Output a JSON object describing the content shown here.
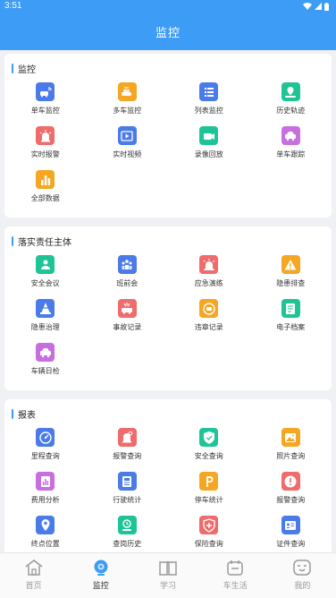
{
  "status": {
    "time": "3:51"
  },
  "header": {
    "title": "监控"
  },
  "colors": {
    "header": "#3d9cf5",
    "blue": "#4a7be8",
    "orange": "#f5a623",
    "green": "#1fc496",
    "red": "#f06b6b",
    "purple": "#c86ee0"
  },
  "sections": [
    {
      "title": "监控",
      "items": [
        {
          "label": "单车监控",
          "icon": "car-signal-icon",
          "color": "#4a7be8"
        },
        {
          "label": "多车监控",
          "icon": "multi-car-icon",
          "color": "#f5a623"
        },
        {
          "label": "列表监控",
          "icon": "list-icon",
          "color": "#4a7be8"
        },
        {
          "label": "历史轨迹",
          "icon": "map-pin-icon",
          "color": "#1fc496"
        },
        {
          "label": "实时报警",
          "icon": "alarm-icon",
          "color": "#f06b6b"
        },
        {
          "label": "实时视频",
          "icon": "video-play-icon",
          "color": "#4a7be8"
        },
        {
          "label": "录像回放",
          "icon": "camera-icon",
          "color": "#1fc496"
        },
        {
          "label": "单车跟踪",
          "icon": "car-track-icon",
          "color": "#c86ee0"
        },
        {
          "label": "全部数据",
          "icon": "bar-chart-icon",
          "color": "#f5a623"
        }
      ]
    },
    {
      "title": "落实责任主体",
      "items": [
        {
          "label": "安全会议",
          "icon": "meeting-icon",
          "color": "#1fc496"
        },
        {
          "label": "班前会",
          "icon": "team-icon",
          "color": "#4a7be8"
        },
        {
          "label": "应急演练",
          "icon": "siren-icon",
          "color": "#f06b6b"
        },
        {
          "label": "隐患排查",
          "icon": "warning-icon",
          "color": "#f5a623"
        },
        {
          "label": "隐患治理",
          "icon": "cone-icon",
          "color": "#4a7be8"
        },
        {
          "label": "事故记录",
          "icon": "accident-icon",
          "color": "#f06b6b"
        },
        {
          "label": "违章记录",
          "icon": "violation-icon",
          "color": "#f5a623"
        },
        {
          "label": "电子档案",
          "icon": "archive-icon",
          "color": "#1fc496"
        },
        {
          "label": "车辆日检",
          "icon": "car-check-icon",
          "color": "#c86ee0"
        }
      ]
    },
    {
      "title": "报表",
      "items": [
        {
          "label": "里程查询",
          "icon": "speedometer-icon",
          "color": "#4a7be8"
        },
        {
          "label": "报警查询",
          "icon": "alarm-search-icon",
          "color": "#f06b6b"
        },
        {
          "label": "安全查询",
          "icon": "shield-icon",
          "color": "#1fc496"
        },
        {
          "label": "照片查询",
          "icon": "photo-icon",
          "color": "#f5a623"
        },
        {
          "label": "费用分析",
          "icon": "cost-chart-icon",
          "color": "#c86ee0"
        },
        {
          "label": "行驶统计",
          "icon": "driving-stats-icon",
          "color": "#4a7be8"
        },
        {
          "label": "停车统计",
          "icon": "parking-icon",
          "color": "#f5a623"
        },
        {
          "label": "报警查询",
          "icon": "alert-circle-icon",
          "color": "#f06b6b"
        },
        {
          "label": "终点位置",
          "icon": "location-icon",
          "color": "#4a7be8"
        },
        {
          "label": "查岗历史",
          "icon": "inspect-history-icon",
          "color": "#1fc496"
        },
        {
          "label": "保险查询",
          "icon": "insurance-icon",
          "color": "#f06b6b"
        },
        {
          "label": "证件查询",
          "icon": "id-card-icon",
          "color": "#4a7be8"
        },
        {
          "label": "",
          "icon": "report-icon",
          "color": "#f5a623"
        }
      ]
    }
  ],
  "tabbar": [
    {
      "label": "首页",
      "icon": "home-icon",
      "active": false
    },
    {
      "label": "监控",
      "icon": "monitor-icon",
      "active": true
    },
    {
      "label": "学习",
      "icon": "book-icon",
      "active": false
    },
    {
      "label": "车生活",
      "icon": "calendar-icon",
      "active": false
    },
    {
      "label": "我的",
      "icon": "profile-icon",
      "active": false
    }
  ]
}
